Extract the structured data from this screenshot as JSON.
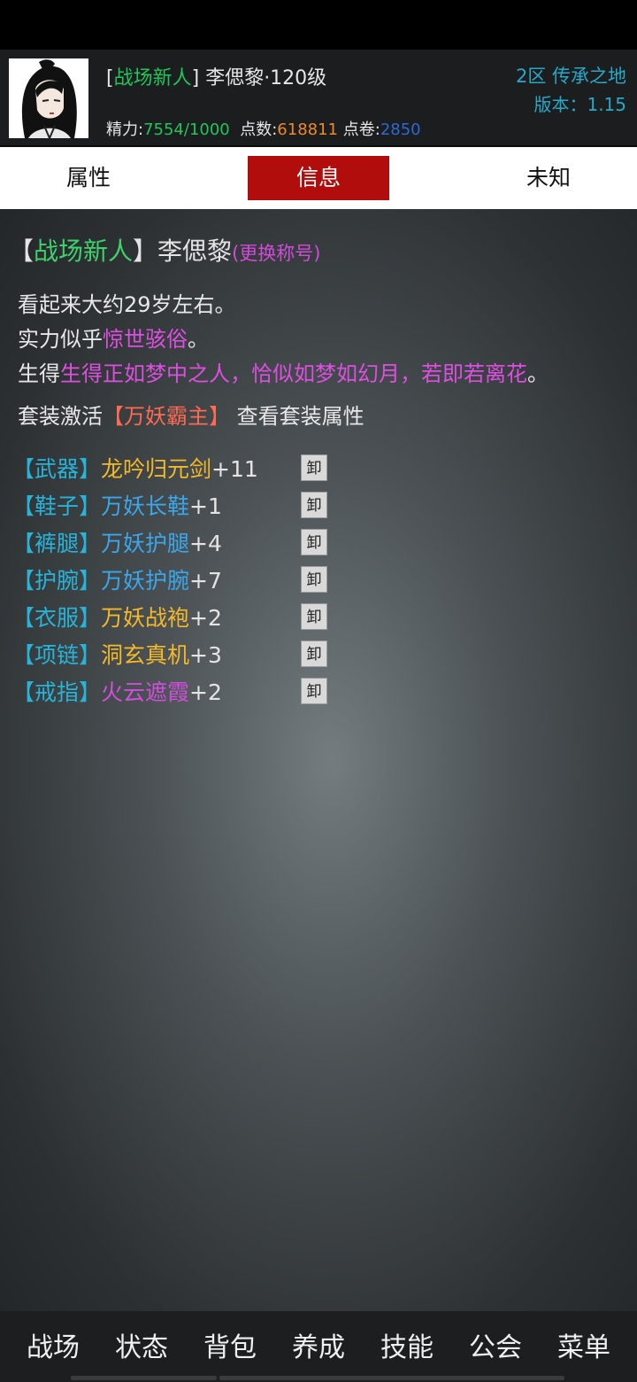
{
  "header": {
    "title_tag": "战场新人",
    "name_level": "李偲黎·120级",
    "energy_label": "精力:",
    "energy_value": "7554/1000",
    "points_label": "点数:",
    "points_value": "618811",
    "vouchers_label": "点卷:",
    "vouchers_value": "2850",
    "server": "2区 传承之地",
    "version": "版本：1.15"
  },
  "tabs": [
    "属性",
    "信息",
    "未知"
  ],
  "active_tab": "信息",
  "info": {
    "title": "战场新人",
    "name": "李偲黎",
    "change_title": "(更换称号)",
    "age_line": "看起来大约29岁左右。",
    "strength_prefix": "实力似乎",
    "strength_value": "惊世骇俗",
    "strength_suffix": "。",
    "looks_prefix": "生得",
    "looks_value": "生得正如梦中之人，恰似如梦如幻月，若即若离花",
    "looks_suffix": "。",
    "suit_prefix": "套装激活",
    "suit_name": "【万妖霸主】",
    "suit_view": "查看套装属性"
  },
  "equipment": [
    {
      "slot": "【武器】",
      "item": "龙吟归元剑",
      "plus": "+11",
      "quality_color": "#f3b92a",
      "unequip": "卸"
    },
    {
      "slot": "【鞋子】",
      "item": "万妖长鞋",
      "plus": "+1",
      "quality_color": "#3aa7ea",
      "unequip": "卸"
    },
    {
      "slot": "【裤腿】",
      "item": "万妖护腿",
      "plus": "+4",
      "quality_color": "#3aa7ea",
      "unequip": "卸"
    },
    {
      "slot": "【护腕】",
      "item": "万妖护腕",
      "plus": "+7",
      "quality_color": "#3aa7ea",
      "unequip": "卸"
    },
    {
      "slot": "【衣服】",
      "item": "万妖战袍",
      "plus": "+2",
      "quality_color": "#f3b92a",
      "unequip": "卸"
    },
    {
      "slot": "【项链】",
      "item": "洞玄真机",
      "plus": "+3",
      "quality_color": "#f3b92a",
      "unequip": "卸"
    },
    {
      "slot": "【戒指】",
      "item": "火云遮霞",
      "plus": "+2",
      "quality_color": "#cf4fdb",
      "unequip": "卸"
    }
  ],
  "bottom_nav": [
    "战场",
    "状态",
    "背包",
    "养成",
    "技能",
    "公会",
    "菜单"
  ],
  "colors": {
    "accent_red": "#b20d0d",
    "slot_cyan": "#27b4d8",
    "title_green": "#1ec65a",
    "server_cyan": "#26a9c9"
  }
}
